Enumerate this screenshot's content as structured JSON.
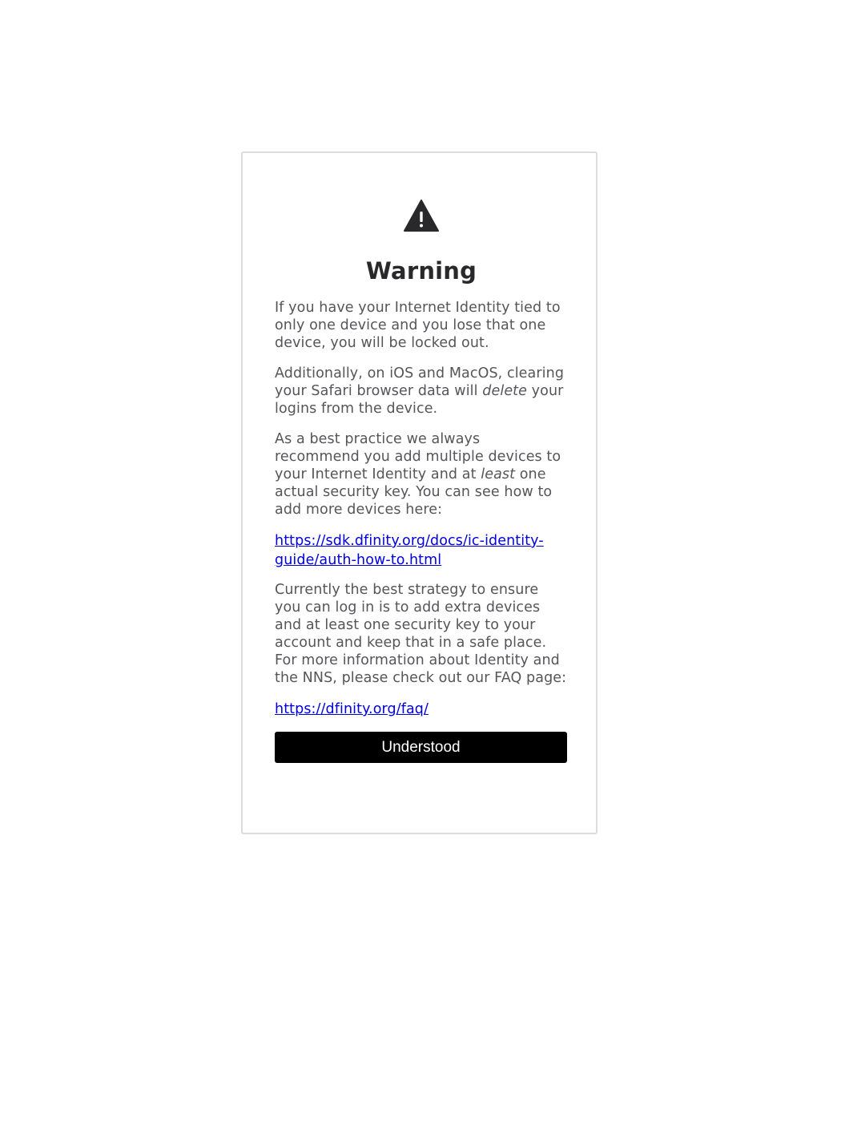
{
  "dialog": {
    "icon": "warning-triangle-icon",
    "title": "Warning",
    "p1": "If you have your Internet Identity tied to only one device and you lose that one device, you will be locked out.",
    "p2_before": "Additionally, on iOS and MacOS, clearing your Safari browser data will ",
    "p2_em": "delete",
    "p2_after": " your logins from the device.",
    "p3_before": "As a best practice we always recommend you add multiple devices to your Internet Identity and at ",
    "p3_em": "least",
    "p3_after": " one actual security key. You can see how to add more devices here:",
    "link1": "https://sdk.dfinity.org/docs/ic-identity-guide/auth-how-to.html",
    "p4": "Currently the best strategy to ensure you can log in is to add extra devices and at least one security key to your account and keep that in a safe place. For more information about Identity and the NNS, please check out our FAQ page:",
    "link2": "https://dfinity.org/faq/",
    "button_label": "Understood"
  },
  "colors": {
    "title": "#29292c",
    "body_text": "#55555a",
    "link": "#0000d8",
    "button_bg": "#000000",
    "button_text": "#ffffff",
    "card_border": "#dcdcdc"
  }
}
